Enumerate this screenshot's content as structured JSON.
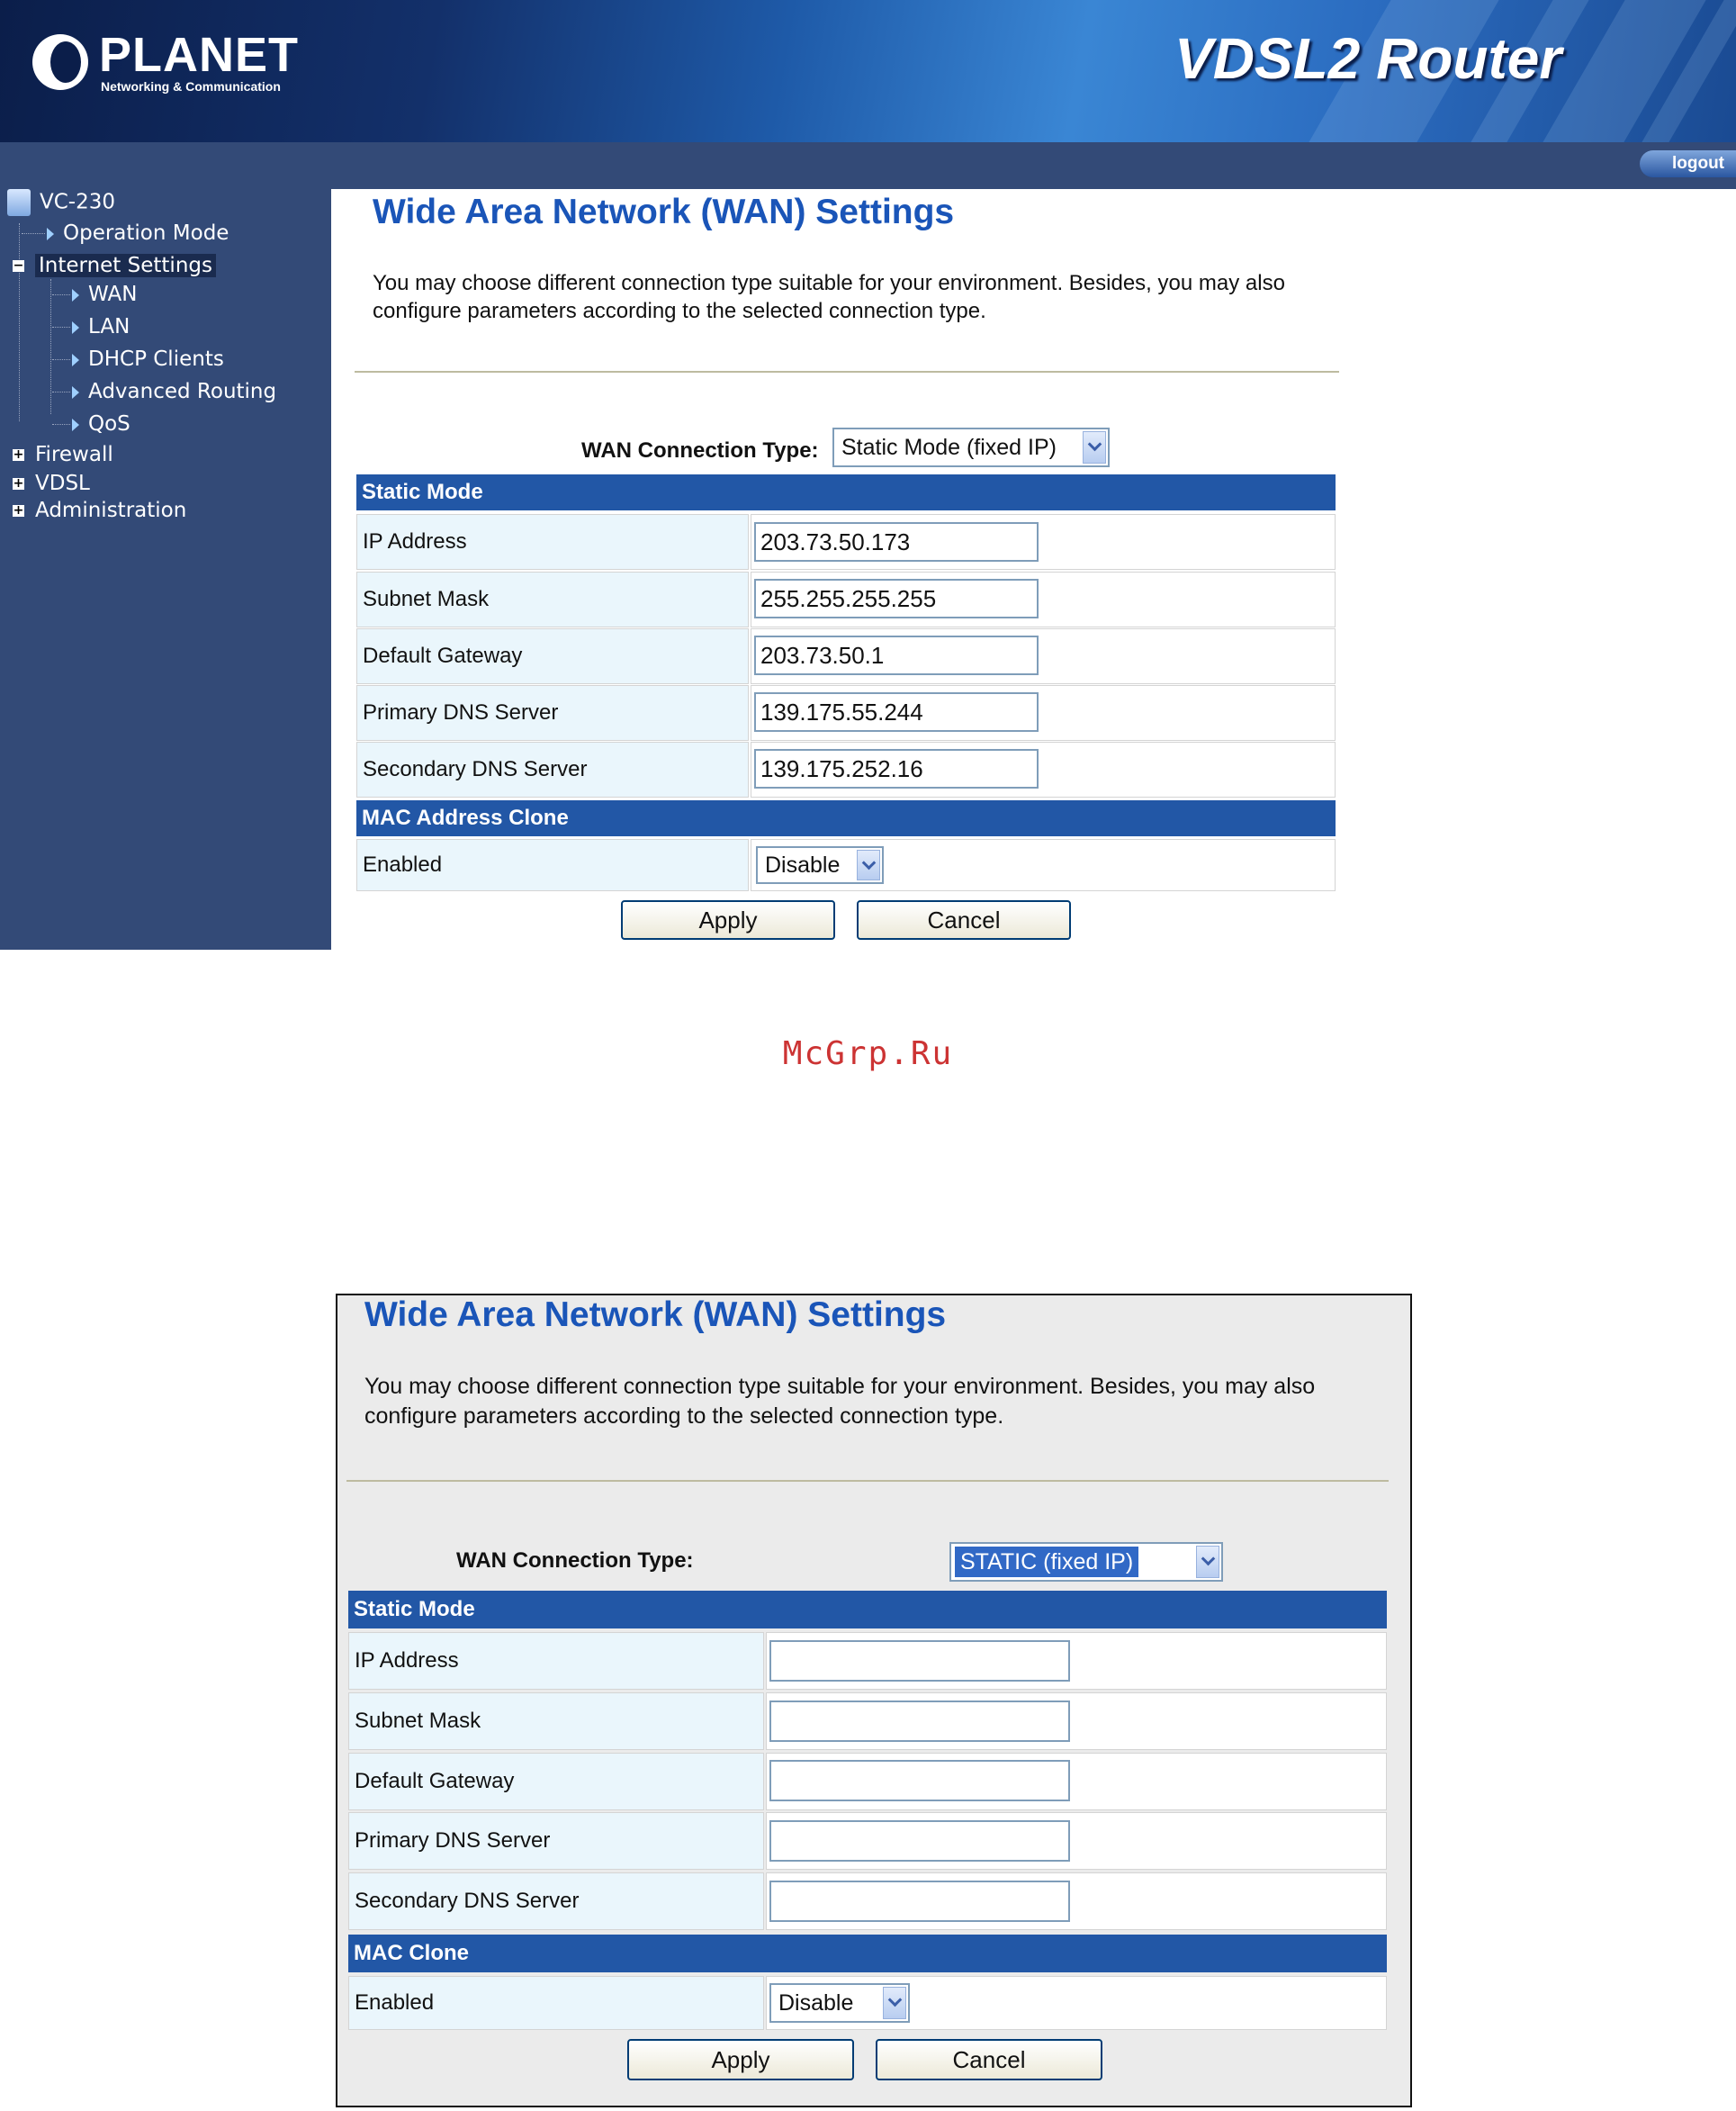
{
  "banner": {
    "logo": "PLANET",
    "logo_sub": "Networking & Communication",
    "title": "VDSL2 Router",
    "logout": "logout"
  },
  "sidebar": {
    "root": "VC-230",
    "items": [
      {
        "label": "Operation Mode"
      },
      {
        "label": "Internet Settings"
      },
      {
        "label": "WAN"
      },
      {
        "label": "LAN"
      },
      {
        "label": "DHCP Clients"
      },
      {
        "label": "Advanced Routing"
      },
      {
        "label": "QoS"
      },
      {
        "label": "Firewall"
      },
      {
        "label": "VDSL"
      },
      {
        "label": "Administration"
      }
    ]
  },
  "top": {
    "title": "Wide Area Network (WAN) Settings",
    "desc_line1": "You may choose different connection type suitable for your environment. Besides, you may also",
    "desc_line2": "configure parameters according to the selected connection type.",
    "conn_type_label": "WAN Connection Type:",
    "conn_type_value": "Static Mode (fixed IP)",
    "static_header": "Static Mode",
    "rows": [
      {
        "label": "IP Address",
        "value": "203.73.50.173"
      },
      {
        "label": "Subnet Mask",
        "value": "255.255.255.255"
      },
      {
        "label": "Default Gateway",
        "value": "203.73.50.1"
      },
      {
        "label": "Primary DNS Server",
        "value": "139.175.55.244"
      },
      {
        "label": "Secondary DNS Server",
        "value": "139.175.252.16"
      }
    ],
    "mac_header": "MAC Address Clone",
    "enabled_label": "Enabled",
    "enabled_value": "Disable",
    "apply": "Apply",
    "cancel": "Cancel"
  },
  "watermark": "McGrp.Ru",
  "bottom": {
    "title": "Wide Area Network (WAN) Settings",
    "desc_line1": "You may choose different connection type suitable for your environment. Besides, you may also",
    "desc_line2": "configure parameters according to the selected connection type.",
    "conn_type_label": "WAN Connection Type:",
    "conn_type_value": "STATIC (fixed IP)",
    "static_header": "Static Mode",
    "rows": [
      {
        "label": "IP Address",
        "value": ""
      },
      {
        "label": "Subnet Mask",
        "value": ""
      },
      {
        "label": "Default Gateway",
        "value": ""
      },
      {
        "label": "Primary DNS Server",
        "value": ""
      },
      {
        "label": "Secondary DNS Server",
        "value": ""
      }
    ],
    "mac_header": "MAC Clone",
    "enabled_label": "Enabled",
    "enabled_value": "Disable",
    "apply": "Apply",
    "cancel": "Cancel"
  }
}
